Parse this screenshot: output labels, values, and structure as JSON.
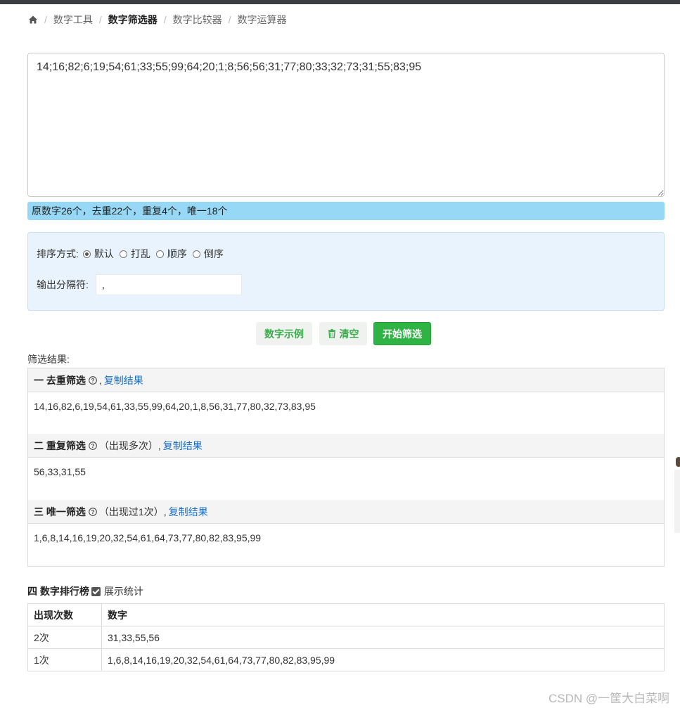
{
  "breadcrumb": {
    "items": [
      {
        "label": "数字工具",
        "active": false
      },
      {
        "label": "数字筛选器",
        "active": true
      },
      {
        "label": "数字比较器",
        "active": false
      },
      {
        "label": "数字运算器",
        "active": false
      }
    ]
  },
  "input": {
    "value": "14;16;82;6;19;54;61;33;55;99;64;20;1;8;56;56;31;77;80;33;32;73;31;55;83;95"
  },
  "stats": {
    "text": "原数字26个，去重22个，重复4个，唯一18个"
  },
  "options": {
    "sort_label": "排序方式:",
    "sort_options": [
      {
        "label": "默认",
        "checked": true
      },
      {
        "label": "打乱",
        "checked": false
      },
      {
        "label": "顺序",
        "checked": false
      },
      {
        "label": "倒序",
        "checked": false
      }
    ],
    "separator_label": "输出分隔符:",
    "separator_value": ","
  },
  "buttons": {
    "example": "数字示例",
    "clear": "清空",
    "start": "开始筛选"
  },
  "results": {
    "label": "筛选结果:",
    "dedupe": {
      "title": "一 去重筛选",
      "note": "",
      "copy": "复制结果",
      "value": "14,16,82,6,19,54,61,33,55,99,64,20,1,8,56,31,77,80,32,73,83,95"
    },
    "repeat": {
      "title": "二 重复筛选",
      "note": "（出现多次）",
      "copy": "复制结果",
      "value": "56,33,31,55"
    },
    "unique": {
      "title": "三 唯一筛选",
      "note": "（出现过1次）",
      "copy": "复制结果",
      "value": "1,6,8,14,16,19,20,32,54,61,64,73,77,80,82,83,95,99"
    }
  },
  "ranking": {
    "title": "四 数字排行榜",
    "show_stats_label": "展示统计",
    "show_stats_checked": true,
    "headers": [
      "出现次数",
      "数字"
    ],
    "rows": [
      {
        "count": "2次",
        "numbers": "31,33,55,56"
      },
      {
        "count": "1次",
        "numbers": "1,6,8,14,16,19,20,32,54,61,64,73,77,80,82,83,95,99"
      }
    ]
  },
  "watermark": "CSDN @一筐大白菜啊",
  "colors": {
    "stats_bg": "#96d8f5",
    "options_bg": "#e8f3fd",
    "primary_green": "#2fb344",
    "link_blue": "#1a6dc4"
  }
}
